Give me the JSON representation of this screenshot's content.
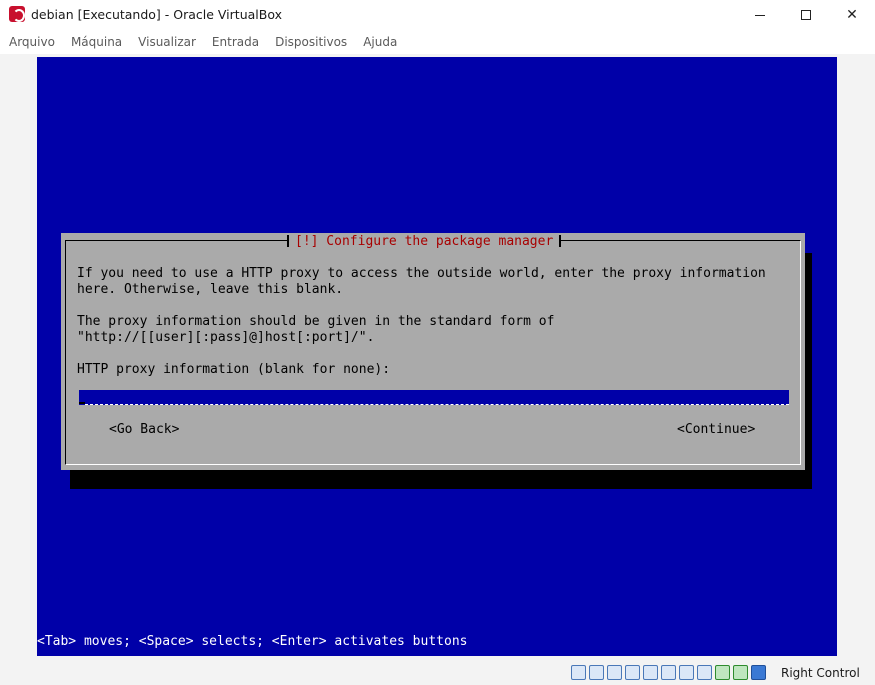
{
  "window": {
    "title": "debian [Executando] - Oracle VirtualBox",
    "icon": "virtualbox-icon"
  },
  "menubar": {
    "items": [
      "Arquivo",
      "Máquina",
      "Visualizar",
      "Entrada",
      "Dispositivos",
      "Ajuda"
    ]
  },
  "installer": {
    "dialog_title": "[!] Configure the package manager",
    "line1": "If you need to use a HTTP proxy to access the outside world, enter the proxy information",
    "line2": "here. Otherwise, leave this blank.",
    "line3": "The proxy information should be given in the standard form of",
    "line4": "\"http://[[user][:pass]@]host[:port]/\".",
    "field_label": "HTTP proxy information (blank for none):",
    "proxy_value": "",
    "go_back_label": "<Go Back>",
    "continue_label": "<Continue>",
    "help_line": "<Tab> moves; <Space> selects; <Enter> activates buttons"
  },
  "statusbar": {
    "host_key": "Right Control",
    "icons": [
      "hard-disk-icon",
      "optical-drive-icon",
      "audio-icon",
      "network-icon",
      "usb-icon",
      "shared-folders-icon",
      "display-icon",
      "video-capture-icon",
      "cpu-icon",
      "mouse-integration-icon",
      "keyboard-icon"
    ]
  },
  "colors": {
    "screen_bg": "#0000a8",
    "dialog_bg": "#aaaaaa",
    "title_red": "#a80000"
  }
}
